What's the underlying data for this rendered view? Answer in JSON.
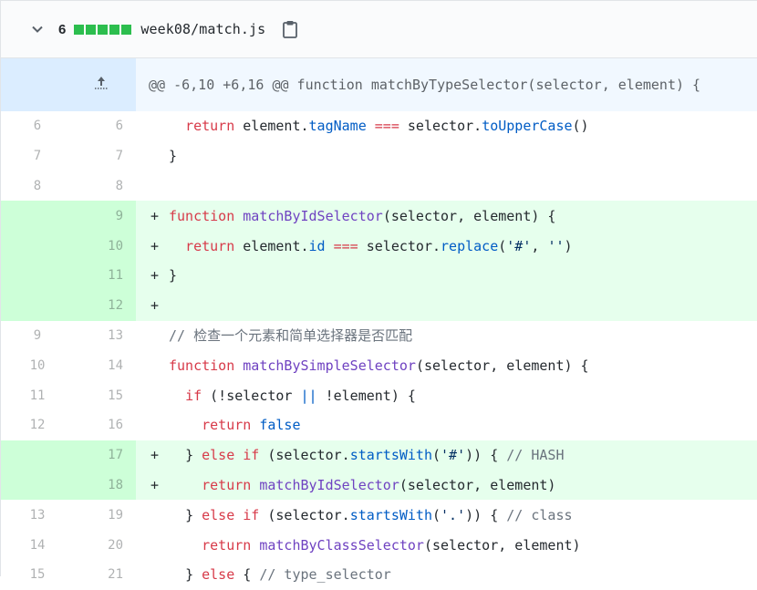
{
  "file": {
    "changes": "6",
    "path": "week08/match.js",
    "colors": {
      "added_block": "#2cbe4e",
      "added_line_bg": "#e6ffed",
      "added_num_bg": "#cdffd8",
      "hunk_bg": "#f1f8ff"
    }
  },
  "hunk": {
    "header": "@@ -6,10 +6,16 @@ function matchByTypeSelector(selector, element) {"
  },
  "lines": [
    {
      "old": "6",
      "new": "6",
      "type": "ctx"
    },
    {
      "old": "7",
      "new": "7",
      "type": "ctx"
    },
    {
      "old": "8",
      "new": "8",
      "type": "ctx"
    },
    {
      "old": "",
      "new": "9",
      "type": "add"
    },
    {
      "old": "",
      "new": "10",
      "type": "add"
    },
    {
      "old": "",
      "new": "11",
      "type": "add"
    },
    {
      "old": "",
      "new": "12",
      "type": "add"
    },
    {
      "old": "9",
      "new": "13",
      "type": "ctx"
    },
    {
      "old": "10",
      "new": "14",
      "type": "ctx"
    },
    {
      "old": "11",
      "new": "15",
      "type": "ctx"
    },
    {
      "old": "12",
      "new": "16",
      "type": "ctx"
    },
    {
      "old": "",
      "new": "17",
      "type": "add"
    },
    {
      "old": "",
      "new": "18",
      "type": "add"
    },
    {
      "old": "13",
      "new": "19",
      "type": "ctx"
    },
    {
      "old": "14",
      "new": "20",
      "type": "ctx"
    },
    {
      "old": "15",
      "new": "21",
      "type": "ctx"
    }
  ],
  "marker_add": "+",
  "code": {
    "l0": {
      "i": "  ",
      "a": "return",
      "b": " element.",
      "c": "tagName",
      "d": " ",
      "e": "===",
      "f": " selector.",
      "g": "toUpperCase",
      "h": "()"
    },
    "l1": {
      "a": "}"
    },
    "l3": {
      "a": "function",
      "b": " ",
      "c": "matchByIdSelector",
      "d": "(selector, element) {"
    },
    "l4": {
      "i": "  ",
      "a": "return",
      "b": " element.",
      "c": "id",
      "d": " ",
      "e": "===",
      "f": " selector.",
      "g": "replace",
      "h": "(",
      "s1": "'#'",
      "j": ", ",
      "s2": "''",
      "k": ")"
    },
    "l5": {
      "a": "}"
    },
    "l7": {
      "a": "// 检查一个元素和简单选择器是否匹配"
    },
    "l8": {
      "a": "function",
      "b": " ",
      "c": "matchBySimpleSelector",
      "d": "(selector, element) {"
    },
    "l9": {
      "i": "  ",
      "a": "if",
      "b": " (!selector ",
      "c": "||",
      "d": " !element) {"
    },
    "l10": {
      "i": "    ",
      "a": "return",
      "b": " ",
      "c": "false"
    },
    "l11": {
      "i": "  ",
      "a": "} ",
      "b": "else",
      "c": " ",
      "d": "if",
      "e": " (selector.",
      "f": "startsWith",
      "g": "(",
      "s": "'#'",
      "h": ")) { ",
      "cm": "// HASH"
    },
    "l12": {
      "i": "    ",
      "a": "return",
      "b": " ",
      "c": "matchByIdSelector",
      "d": "(selector, element)"
    },
    "l13": {
      "i": "  ",
      "a": "} ",
      "b": "else",
      "c": " ",
      "d": "if",
      "e": " (selector.",
      "f": "startsWith",
      "g": "(",
      "s": "'.'",
      "h": ")) { ",
      "cm": "// class"
    },
    "l14": {
      "i": "    ",
      "a": "return",
      "b": " ",
      "c": "matchByClassSelector",
      "d": "(selector, element)"
    },
    "l15": {
      "i": "  ",
      "a": "} ",
      "b": "else",
      "c": " { ",
      "cm": "// type_selector"
    }
  }
}
